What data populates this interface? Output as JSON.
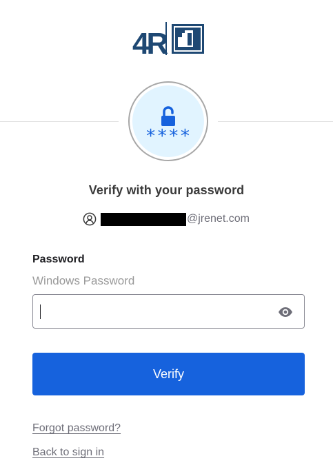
{
  "logo": {
    "text": "4R",
    "brand_color": "#1e4873"
  },
  "factor": {
    "icon": "unlock-icon",
    "mask": "****",
    "accent_color": "#1662dd"
  },
  "title": "Verify with your password",
  "identifier": {
    "icon": "user-circle-icon",
    "email_suffix": "@jrenet.com"
  },
  "password_field": {
    "label": "Password",
    "hint": "Windows Password",
    "value": "",
    "toggle_icon": "eye-icon"
  },
  "verify_button": {
    "label": "Verify",
    "color": "#1662dd"
  },
  "links": {
    "forgot_password": "Forgot password?",
    "back_to_sign_in": "Back to sign in"
  }
}
